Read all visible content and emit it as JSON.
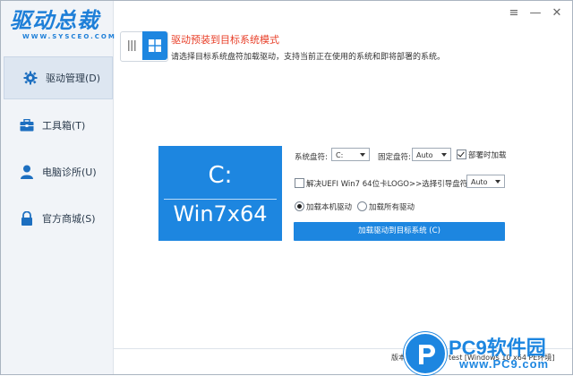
{
  "app": {
    "logo_text": "驱动总裁",
    "logo_sub": "WWW.SYSCEO.COM"
  },
  "window_buttons": {
    "menu": "≡",
    "minimize": "—",
    "close": "✕"
  },
  "sidebar": {
    "items": [
      {
        "label": "驱动管理(D)",
        "icon": "gear-icon",
        "active": true
      },
      {
        "label": "工具箱(T)",
        "icon": "toolbox-icon",
        "active": false
      },
      {
        "label": "电脑诊所(U)",
        "icon": "user-icon",
        "active": false
      },
      {
        "label": "官方商城(S)",
        "icon": "lock-icon",
        "active": false
      }
    ]
  },
  "mode": {
    "title": "驱动预装到目标系统模式",
    "description": "请选择目标系统盘符加载驱动，支持当前正在使用的系统和即将部署的系统。"
  },
  "tile": {
    "drive": "C:",
    "os": "Win7x64"
  },
  "controls": {
    "system_drive_label": "系统盘符:",
    "system_drive_value": "C:",
    "fixed_drive_label": "固定盘符:",
    "fixed_drive_value": "Auto",
    "deploy_load_label": "部署时加载",
    "deploy_load_checked": true,
    "uefi_label": "解决UEFI Win7 64位卡LOGO>>选择引导盘符:",
    "uefi_checked": false,
    "boot_drive_value": "Auto",
    "radio_local": "加载本机驱动",
    "radio_all": "加载所有驱动",
    "radio_selected": "local",
    "load_button": "加载驱动到目标系统 (C)"
  },
  "footer": {
    "version_text": "版本：",
    "status_text": "test [Windows 10 x64 PE环境]"
  },
  "watermark": {
    "brand": "PC9软件园",
    "url": "www.PC9.com"
  },
  "colors": {
    "accent": "#1d86e0",
    "title_red": "#e8402a"
  }
}
